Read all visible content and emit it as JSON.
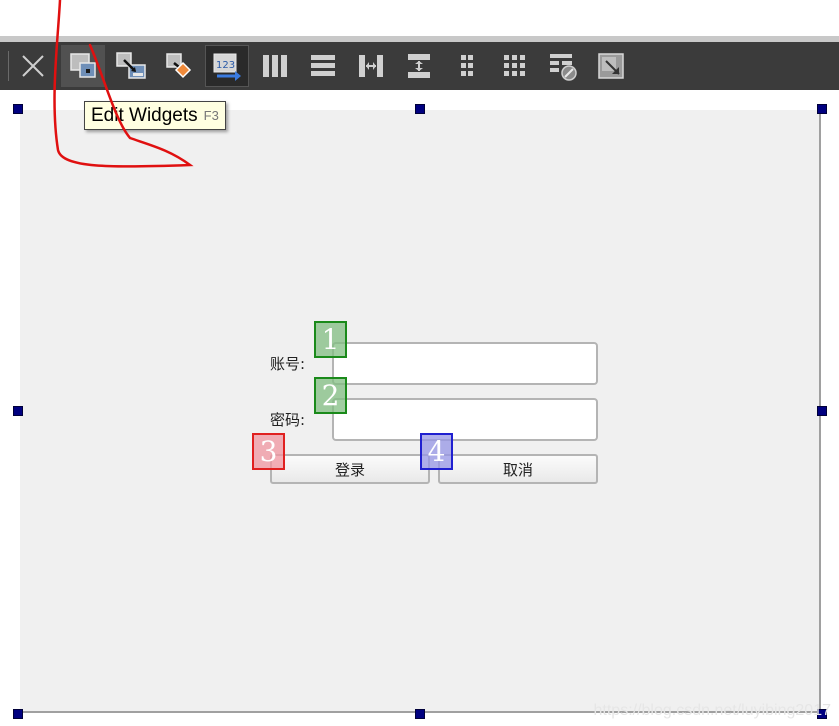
{
  "toolbar": {
    "buttons": [
      {
        "name": "close",
        "icon": "close-icon"
      },
      {
        "name": "edit-widgets",
        "icon": "edit-widgets-icon",
        "state": "hover"
      },
      {
        "name": "edit-signals-slots",
        "icon": "signals-slots-icon"
      },
      {
        "name": "edit-buddies",
        "icon": "buddies-icon"
      },
      {
        "name": "edit-tab-order",
        "icon": "tab-order-icon",
        "state": "active"
      },
      {
        "name": "layout-horizontally",
        "icon": "layout-horizontal-icon"
      },
      {
        "name": "layout-vertically",
        "icon": "layout-vertical-icon"
      },
      {
        "name": "layout-horizontal-splitter",
        "icon": "horizontal-splitter-icon"
      },
      {
        "name": "layout-vertical-splitter",
        "icon": "vertical-splitter-icon"
      },
      {
        "name": "layout-form",
        "icon": "form-layout-icon"
      },
      {
        "name": "layout-grid",
        "icon": "grid-layout-icon"
      },
      {
        "name": "break-layout",
        "icon": "break-layout-icon"
      },
      {
        "name": "adjust-size",
        "icon": "adjust-size-icon"
      }
    ],
    "tab_order_icon_text": "123"
  },
  "tooltip": {
    "text": "Edit Widgets",
    "shortcut": "F3"
  },
  "form": {
    "account_label": "账号:",
    "password_label": "密码:",
    "login_button": "登录",
    "cancel_button": "取消"
  },
  "tab_order": [
    "1",
    "2",
    "3",
    "4"
  ],
  "colors": {
    "handle": "#000080",
    "toolbar": "#3b3b3b",
    "canvas": "#f0f0f0",
    "scribble": "#e01010"
  },
  "watermark": "https://blog.csdn.net/luyibing2017"
}
